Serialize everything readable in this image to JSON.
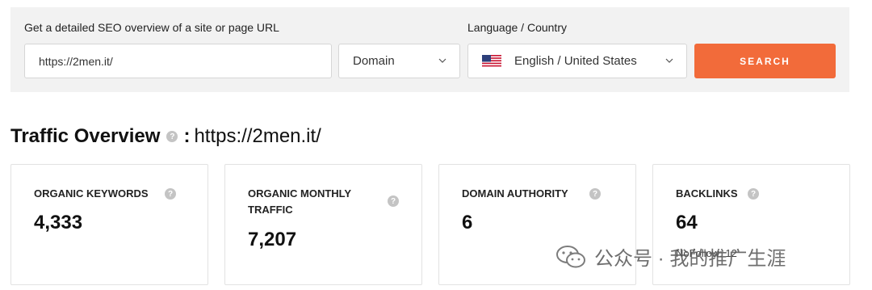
{
  "search": {
    "url_label": "Get a detailed SEO overview of a site or page URL",
    "url_value": "https://2men.it/",
    "scope_select": "Domain",
    "lang_label": "Language / Country",
    "lang_select": "English / United States",
    "search_button": "SEARCH",
    "accent_color": "#f26b3a"
  },
  "overview": {
    "title": "Traffic Overview",
    "help": "?",
    "colon": ":",
    "url": "https://2men.it/"
  },
  "cards": [
    {
      "label": "ORGANIC KEYWORDS",
      "value": "4,333"
    },
    {
      "label_line1": "ORGANIC MONTHLY",
      "label_line2": "TRAFFIC",
      "value": "7,207"
    },
    {
      "label": "DOMAIN AUTHORITY",
      "value": "6"
    },
    {
      "label": "BACKLINKS",
      "value": "64",
      "sub": "NoFollow: 12"
    }
  ],
  "watermark": {
    "text": "公众号 · 我的推广生涯"
  }
}
